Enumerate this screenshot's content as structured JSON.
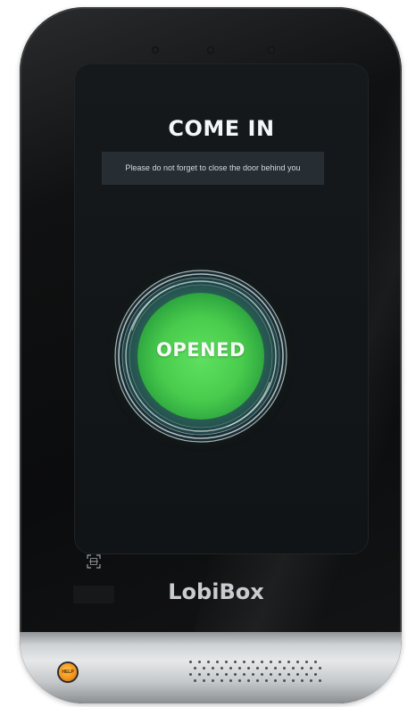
{
  "screen": {
    "title": "COME IN",
    "notice": "Please do not forget to close the door behind you",
    "status_label": "OPENED",
    "status_color": "#4fd24f"
  },
  "device": {
    "brand": "LobiBox",
    "help_button_label": "HELP",
    "help_button_color": "#f2911b",
    "scan_icon": "scan-frame-icon"
  }
}
